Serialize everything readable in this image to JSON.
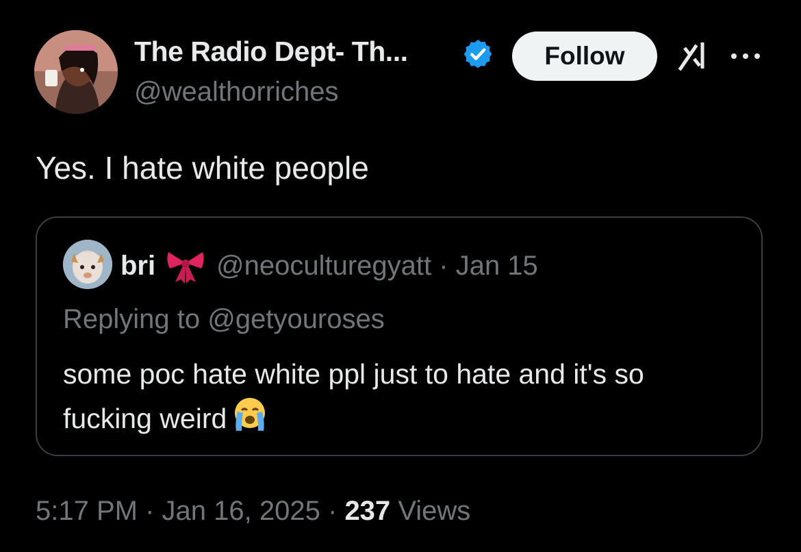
{
  "author": {
    "display_name": "The Radio Dept- Th...",
    "handle": "@wealthorriches",
    "verified": true
  },
  "header": {
    "follow_label": "Follow",
    "grok_icon": "grok-icon",
    "more_icon": "more-icon"
  },
  "tweet": {
    "text": "Yes. I hate white people"
  },
  "quote": {
    "name": "bri",
    "name_icon": "ribbon-bow",
    "handle": "@neoculturegyatt",
    "separator": "·",
    "date": "Jan 15",
    "replying_to": "Replying to @getyouroses",
    "text": "some poc hate white ppl just to hate and it's so fucking weird",
    "emoji": "loudly-crying-face"
  },
  "footer": {
    "time": "5:17 PM",
    "separator": "·",
    "date": "Jan 16, 2025",
    "views_count": "237",
    "views_label": "Views"
  },
  "colors": {
    "background": "#000000",
    "text_primary": "#e7e9ea",
    "text_secondary": "#71767b",
    "verified_blue": "#1d9bf0",
    "border": "#3a3e42"
  }
}
